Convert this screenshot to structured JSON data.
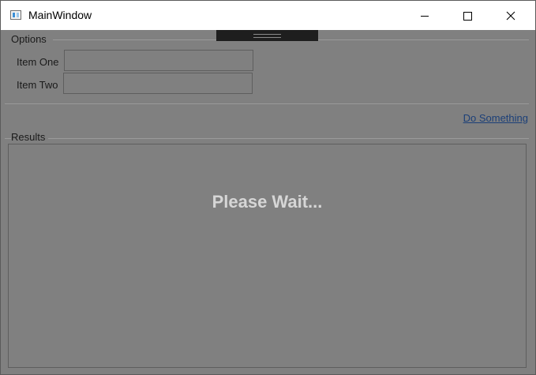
{
  "window": {
    "title": "MainWindow",
    "icon": "app-window-icon",
    "controls": [
      "minimize-icon",
      "maximize-icon",
      "close-icon"
    ]
  },
  "options": {
    "group_label": "Options",
    "item_one_label": "Item One",
    "item_one_value": "",
    "item_two_label": "Item Two",
    "item_two_value": ""
  },
  "action": {
    "link_label": "Do Something"
  },
  "results": {
    "group_label": "Results",
    "busy_message": "Please Wait..."
  },
  "colors": {
    "overlay": "#808080",
    "link": "#1b3f78",
    "busy_text": "#d6d6d6"
  }
}
